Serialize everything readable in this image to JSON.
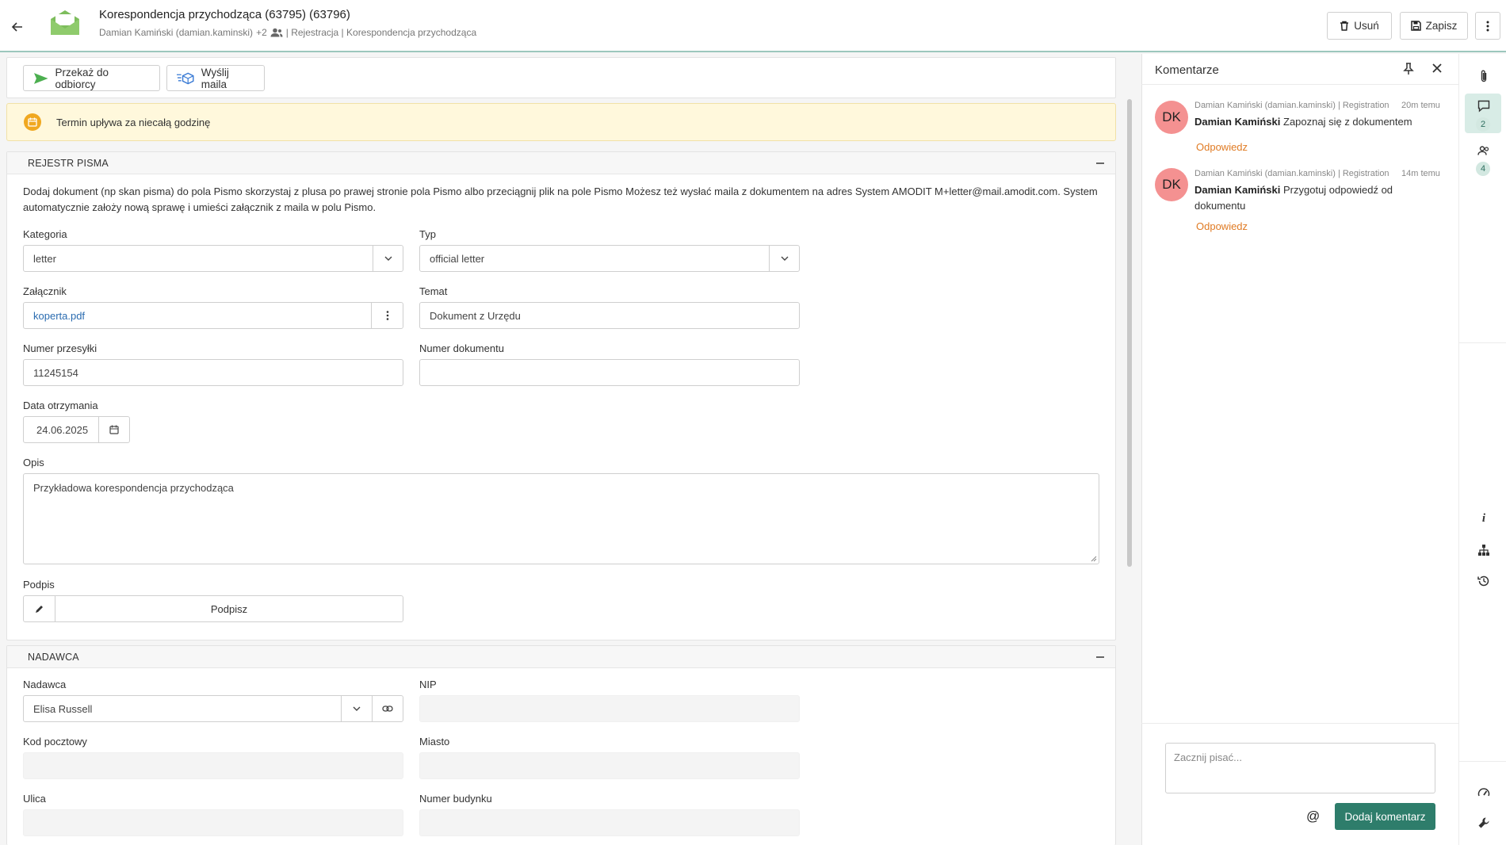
{
  "header": {
    "title": "Korespondencja przychodząca (63795) (63796)",
    "user": "Damian Kamiński (damian.kaminski)",
    "plus_count": "+2",
    "path": "| Rejestracja | Korespondencja przychodząca",
    "delete_label": "Usuń",
    "save_label": "Zapisz"
  },
  "toolbar": {
    "forward_label": "Przekaż do odbiorcy",
    "send_mail_label": "Wyślij maila"
  },
  "alert": {
    "text": "Termin upływa za niecałą godzinę"
  },
  "register": {
    "title": "REJESTR PISMA",
    "info": "Dodaj dokument (np skan pisma) do pola Pismo skorzystaj z plusa po prawej stronie pola Pismo albo przeciągnij plik na pole Pismo Możesz też wysłać maila z dokumentem na adres System AMODIT M+letter@mail.amodit.com. System automatycznie założy nową sprawę i umieści załącznik z maila w polu Pismo.",
    "category_label": "Kategoria",
    "category_value": "letter",
    "type_label": "Typ",
    "type_value": "official letter",
    "attachment_label": "Załącznik",
    "attachment_value": "koperta.pdf",
    "subject_label": "Temat",
    "subject_value": "Dokument z Urzędu",
    "shipment_label": "Numer przesyłki",
    "shipment_value": "11245154",
    "docnum_label": "Numer dokumentu",
    "docnum_value": "",
    "date_label": "Data otrzymania",
    "date_value": "24.06.2025",
    "desc_label": "Opis",
    "desc_value": "Przykładowa korespondencja przychodząca",
    "sign_label": "Podpis",
    "sign_button": "Podpisz"
  },
  "sender": {
    "title": "NADAWCA",
    "sender_label": "Nadawca",
    "sender_value": "Elisa Russell",
    "nip_label": "NIP",
    "postal_label": "Kod pocztowy",
    "city_label": "Miasto",
    "street_label": "Ulica",
    "building_label": "Numer budynku"
  },
  "comments": {
    "title": "Komentarze",
    "items": [
      {
        "initials": "DK",
        "meta": "Damian Kamiński (damian.kaminski) | Registration",
        "time": "20m temu",
        "author": "Damian Kamiński",
        "text": "Zapoznaj się z dokumentem",
        "reply": "Odpowiedz"
      },
      {
        "initials": "DK",
        "meta": "Damian Kamiński (damian.kaminski) | Registration",
        "time": "14m temu",
        "author": "Damian Kamiński",
        "text": "Przygotuj odpowiedź od dokumentu",
        "reply": "Odpowiedz"
      }
    ],
    "placeholder": "Zacznij pisać...",
    "at_symbol": "@",
    "add_label": "Dodaj komentarz"
  },
  "rail": {
    "comments_count": "2",
    "users_count": "4",
    "info_glyph": "i"
  },
  "colors": {
    "accent": "#2e7d6b",
    "avatar": "#f49191",
    "reply": "#e07b24",
    "alert_bg": "#fff8dc"
  }
}
